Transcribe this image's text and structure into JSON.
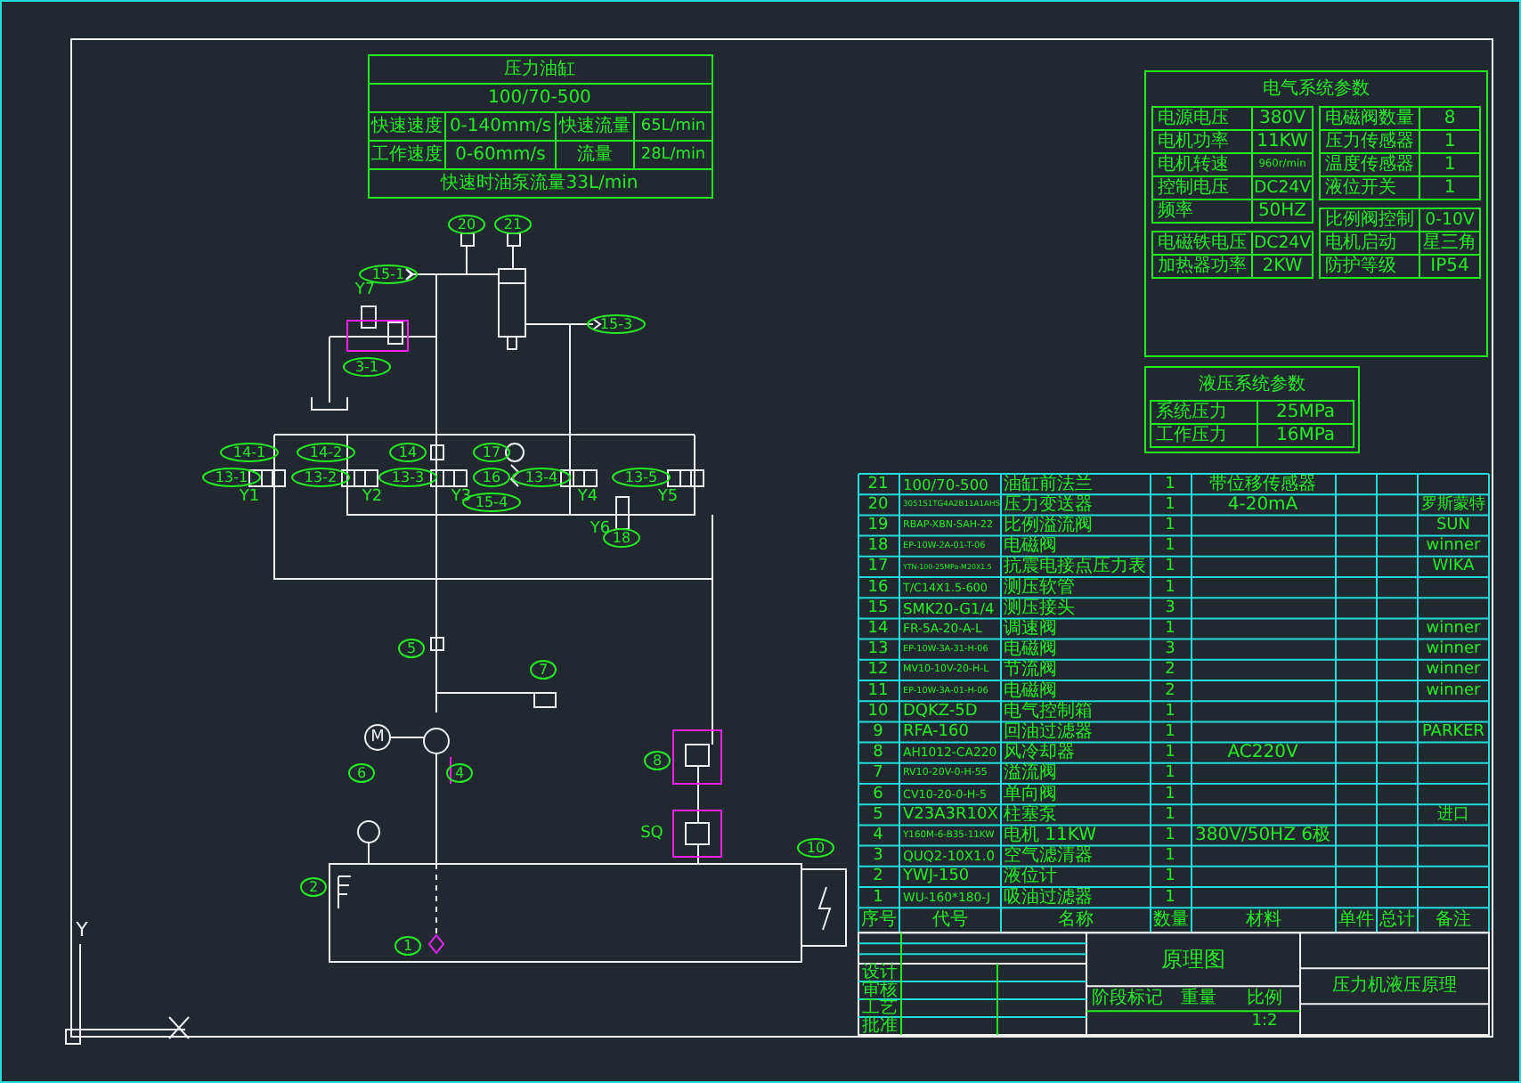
{
  "pressure_table": {
    "title": "压力油缸",
    "model": "100/70-500",
    "rows": [
      [
        "快速速度",
        "0-140mm/s",
        "快速流量",
        "65L/min"
      ],
      [
        "工作速度",
        "0-60mm/s",
        "流量",
        "28L/min"
      ]
    ],
    "note": "快速时油泵流量33L/min"
  },
  "electrical_params": {
    "title": "电气系统参数",
    "left_rows": [
      [
        "电源电压",
        "380V"
      ],
      [
        "电机功率",
        "11KW"
      ],
      [
        "电机转速",
        "960r/min"
      ],
      [
        "控制电压",
        "DC24V"
      ],
      [
        "频率",
        "50HZ"
      ]
    ],
    "left_rows_2": [
      [
        "电磁铁电压",
        "DC24V"
      ],
      [
        "加热器功率",
        "2KW"
      ]
    ],
    "right_rows": [
      [
        "电磁阀数量",
        "8"
      ],
      [
        "压力传感器",
        "1"
      ],
      [
        "温度传感器",
        "1"
      ],
      [
        "液位开关",
        "1"
      ]
    ],
    "right_rows_2": [
      [
        "比例阀控制",
        "0-10V"
      ],
      [
        "电机启动",
        "星三角"
      ],
      [
        "防护等级",
        "IP54"
      ]
    ]
  },
  "hydraulic_params": {
    "title": "液压系统参数",
    "rows": [
      [
        "系统压力",
        "25MPa"
      ],
      [
        "工作压力",
        "16MPa"
      ]
    ]
  },
  "schematic": {
    "callouts": [
      "20",
      "21",
      "15-1",
      "15-3",
      "3-1",
      "14-1",
      "14-2",
      "14",
      "13-1",
      "13-2",
      "13-3",
      "17",
      "16",
      "15-4",
      "13-4",
      "13-5",
      "18",
      "7",
      "5",
      "8",
      "4",
      "6",
      "10",
      "2",
      "1"
    ],
    "labels": [
      "Y7",
      "Y1",
      "Y2",
      "Y3",
      "Y4",
      "Y5",
      "Y6",
      "SQ"
    ],
    "motor": "M"
  },
  "bom": {
    "rows": [
      {
        "no": "21",
        "code": "100/70-500",
        "name": "油缸前法兰",
        "qty": "1",
        "spec": "带位移传感器",
        "brand": ""
      },
      {
        "no": "20",
        "code": "3051S1TG4A2B11A1AHS",
        "name": "压力变送器",
        "qty": "1",
        "spec": "4-20mA",
        "brand": "罗斯蒙特"
      },
      {
        "no": "19",
        "code": "RBAP-XBN-SAH-22",
        "name": "比例溢流阀",
        "qty": "1",
        "spec": "",
        "brand": "SUN"
      },
      {
        "no": "18",
        "code": "EP-10W-2A-01-T-06",
        "name": "电磁阀",
        "qty": "1",
        "spec": "",
        "brand": "winner"
      },
      {
        "no": "17",
        "code": "YTN-100-25MPa-M20X1.5",
        "name": "抗震电接点压力表",
        "qty": "1",
        "spec": "",
        "brand": "WIKA"
      },
      {
        "no": "16",
        "code": "T/C14X1.5-600",
        "name": "测压软管",
        "qty": "1",
        "spec": "",
        "brand": ""
      },
      {
        "no": "15",
        "code": "SMK20-G1/4",
        "name": "测压接头",
        "qty": "3",
        "spec": "",
        "brand": ""
      },
      {
        "no": "14",
        "code": "FR-5A-20-A-L",
        "name": "调速阀",
        "qty": "1",
        "spec": "",
        "brand": "winner"
      },
      {
        "no": "13",
        "code": "EP-10W-3A-31-H-06",
        "name": "电磁阀",
        "qty": "3",
        "spec": "",
        "brand": "winner"
      },
      {
        "no": "12",
        "code": "MV10-10V-20-H-L",
        "name": "节流阀",
        "qty": "2",
        "spec": "",
        "brand": "winner"
      },
      {
        "no": "11",
        "code": "EP-10W-3A-01-H-06",
        "name": "电磁阀",
        "qty": "2",
        "spec": "",
        "brand": "winner"
      },
      {
        "no": "10",
        "code": "DQKZ-5D",
        "name": "电气控制箱",
        "qty": "1",
        "spec": "",
        "brand": ""
      },
      {
        "no": "9",
        "code": "RFA-160",
        "name": "回油过滤器",
        "qty": "1",
        "spec": "",
        "brand": "PARKER"
      },
      {
        "no": "8",
        "code": "AH1012-CA220",
        "name": "风冷却器",
        "qty": "1",
        "spec": "AC220V",
        "brand": ""
      },
      {
        "no": "7",
        "code": "RV10-20V-0-H-55",
        "name": "溢流阀",
        "qty": "1",
        "spec": "",
        "brand": ""
      },
      {
        "no": "6",
        "code": "CV10-20-0-H-5",
        "name": "单向阀",
        "qty": "1",
        "spec": "",
        "brand": ""
      },
      {
        "no": "5",
        "code": "V23A3R10X",
        "name": "柱塞泵",
        "qty": "1",
        "spec": "",
        "brand": "进口"
      },
      {
        "no": "4",
        "code": "Y160M-6-B35-11KW",
        "name": "电机 11KW",
        "qty": "1",
        "spec": "380V/50HZ 6极",
        "brand": ""
      },
      {
        "no": "3",
        "code": "QUQ2-10X1.0",
        "name": "空气滤清器",
        "qty": "1",
        "spec": "",
        "brand": ""
      },
      {
        "no": "2",
        "code": "YWJ-150",
        "name": "液位计",
        "qty": "1",
        "spec": "",
        "brand": ""
      },
      {
        "no": "1",
        "code": "WU-160*180-J",
        "name": "吸油过滤器",
        "qty": "1",
        "spec": "",
        "brand": ""
      }
    ],
    "header": [
      "序号",
      "代号",
      "名称",
      "数量",
      "材料",
      "单件",
      "总计",
      "备注"
    ]
  },
  "title_block": {
    "drawing_title": "原理图",
    "project": "压力机液压原理",
    "signoff": [
      "设计",
      "审核",
      "工艺",
      "批准"
    ],
    "meta_labels": [
      "阶段标记",
      "重量",
      "比例"
    ],
    "scale": "1:2"
  },
  "axis": {
    "y_label": "Y"
  }
}
